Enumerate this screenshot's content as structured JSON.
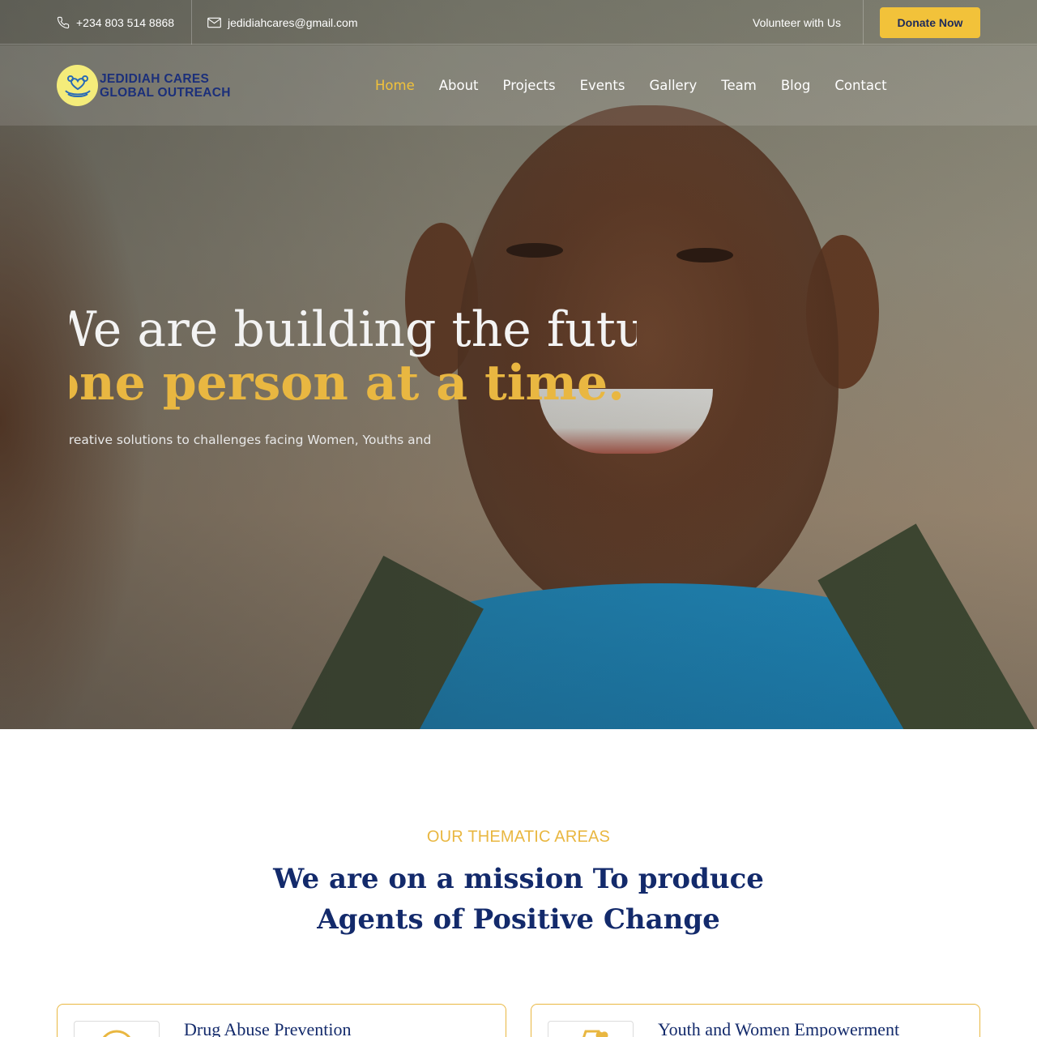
{
  "topbar": {
    "phone": "+234 803 514 8868",
    "email": "jedidiahcares@gmail.com",
    "volunteer_label": "Volunteer with Us",
    "donate_label": "Donate Now"
  },
  "brand": {
    "line1": "JEDIDIAH CARES",
    "line2": "GLOBAL OUTREACH",
    "logo_icon": "hands-heart-logo"
  },
  "nav": {
    "items": [
      {
        "label": "Home",
        "active": true
      },
      {
        "label": "About"
      },
      {
        "label": "Projects"
      },
      {
        "label": "Events"
      },
      {
        "label": "Gallery"
      },
      {
        "label": "Team"
      },
      {
        "label": "Blog"
      },
      {
        "label": "Contact"
      }
    ]
  },
  "hero": {
    "line1": "We are building the future",
    "line2": "one person at a time.",
    "subtitle": "Creative solutions to challenges facing Women, Youths and"
  },
  "thematic": {
    "eyebrow": "OUR THEMATIC AREAS",
    "heading_line1": "We are on a mission To produce",
    "heading_line2": "Agents of Positive Change",
    "cards": [
      {
        "title": "Drug Abuse Prevention",
        "icon": "circle-icon"
      },
      {
        "title": "Youth and Women Empowerment",
        "icon": "house-heart-icon"
      }
    ]
  },
  "colors": {
    "accent": "#f2c23a",
    "heading": "#132a6b",
    "gold_text": "#e9b741"
  }
}
